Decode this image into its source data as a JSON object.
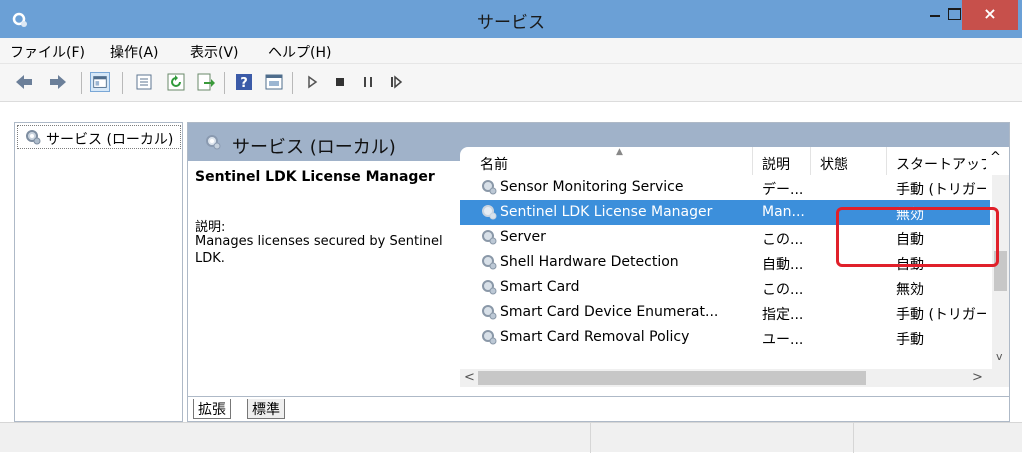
{
  "window": {
    "title": "サービス",
    "close_label": "×",
    "colors": {
      "titlebar": "#6ba0d6",
      "close": "#c7504b",
      "selection": "#3c8fdb",
      "highlight": "#e0202a"
    }
  },
  "menu": {
    "file": "ファイル(F)",
    "action": "操作(A)",
    "view": "表示(V)",
    "help": "ヘルプ(H)"
  },
  "toolbar": {
    "icons": [
      "back-icon",
      "forward-icon",
      "show-console-tree-icon",
      "properties-icon",
      "refresh-icon",
      "export-list-icon",
      "help-icon",
      "console-icon",
      "start-icon",
      "stop-icon",
      "pause-icon",
      "restart-icon"
    ]
  },
  "tree": {
    "root_label": "サービス (ローカル)"
  },
  "detail": {
    "header_title": "サービス (ローカル)",
    "service_name": "Sentinel LDK License Manager",
    "description_label": "説明:",
    "description_text": "Manages licenses secured by Sentinel LDK."
  },
  "list": {
    "columns": {
      "name": "名前",
      "description": "説明",
      "status": "状態",
      "startup": "スタートアップの"
    },
    "rows": [
      {
        "name": "Sensor Monitoring Service",
        "description": "デー...",
        "status": "",
        "startup": "手動 (トリガー開"
      },
      {
        "name": "Sentinel LDK License Manager",
        "description": "Man...",
        "status": "",
        "startup": "無効"
      },
      {
        "name": "Server",
        "description": "この...",
        "status": "",
        "startup": "自動"
      },
      {
        "name": "Shell Hardware Detection",
        "description": "自動...",
        "status": "",
        "startup": "自動"
      },
      {
        "name": "Smart Card",
        "description": "この...",
        "status": "",
        "startup": "無効"
      },
      {
        "name": "Smart Card Device Enumerat...",
        "description": "指定...",
        "status": "",
        "startup": "手動 (トリガー開"
      },
      {
        "name": "Smart Card Removal Policy",
        "description": "ユー...",
        "status": "",
        "startup": "手動"
      }
    ],
    "selected_row": 1,
    "scroll_up": "^",
    "scroll_down": "v",
    "scroll_left": "<",
    "scroll_right": ">"
  },
  "tabs": {
    "extended": "拡張",
    "standard": "標準"
  }
}
